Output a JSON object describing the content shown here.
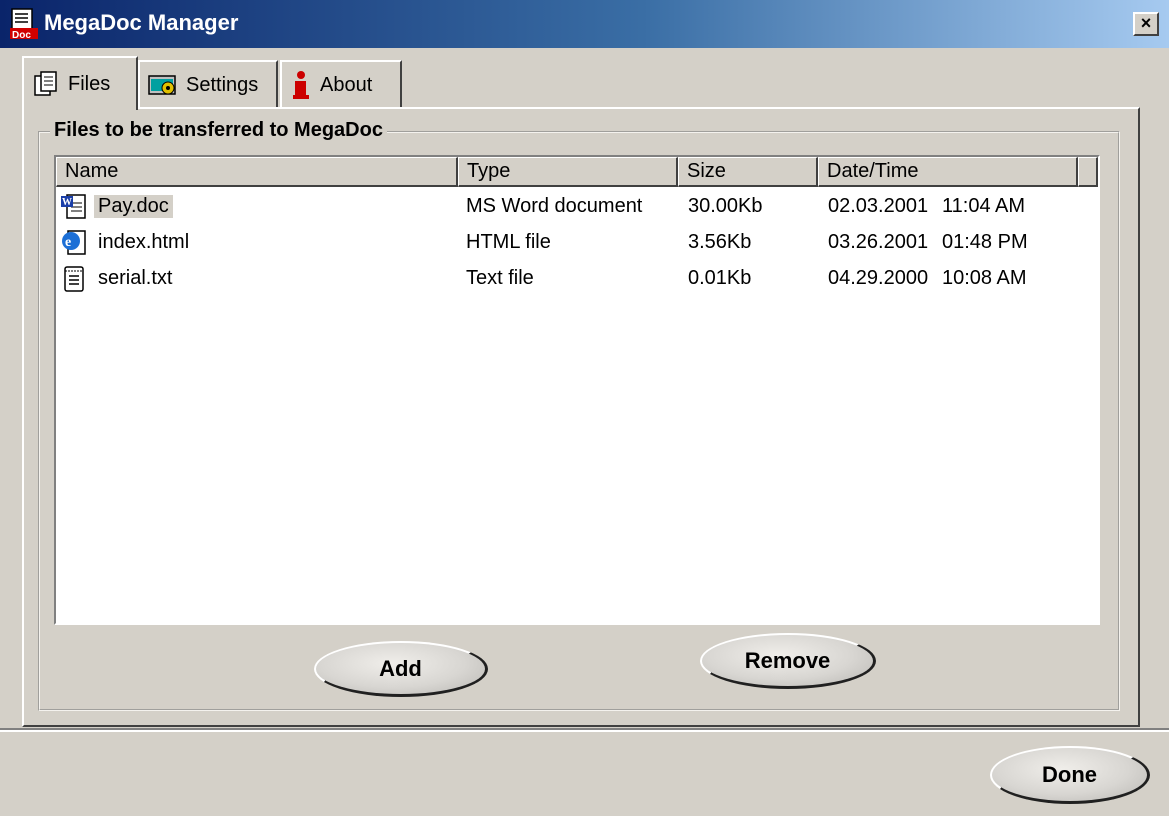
{
  "window": {
    "title": "MegaDoc Manager",
    "close_glyph": "×"
  },
  "tabs": [
    {
      "label": "Files",
      "icon": "files-icon"
    },
    {
      "label": "Settings",
      "icon": "settings-icon"
    },
    {
      "label": "About",
      "icon": "info-icon"
    }
  ],
  "group": {
    "title": "Files to be transferred to MegaDoc"
  },
  "list": {
    "columns": [
      "Name",
      "Type",
      "Size",
      "Date/Time"
    ],
    "rows": [
      {
        "name": "Pay.doc",
        "type": "MS Word document",
        "size": "30.00Kb",
        "date": "02.03.2001",
        "time": "11:04 AM",
        "icon": "word-document-icon"
      },
      {
        "name": "index.html",
        "type": "HTML file",
        "size": "3.56Kb",
        "date": "03.26.2001",
        "time": "01:48 PM",
        "icon": "html-file-icon"
      },
      {
        "name": "serial.txt",
        "type": "Text file",
        "size": "0.01Kb",
        "date": "04.29.2000",
        "time": "10:08 AM",
        "icon": "text-file-icon"
      }
    ]
  },
  "buttons": {
    "add": "Add",
    "remove": "Remove",
    "done": "Done"
  },
  "colors": {
    "title_start": "#0a246a",
    "title_end": "#a6caf0",
    "face": "#d4d0c8"
  }
}
